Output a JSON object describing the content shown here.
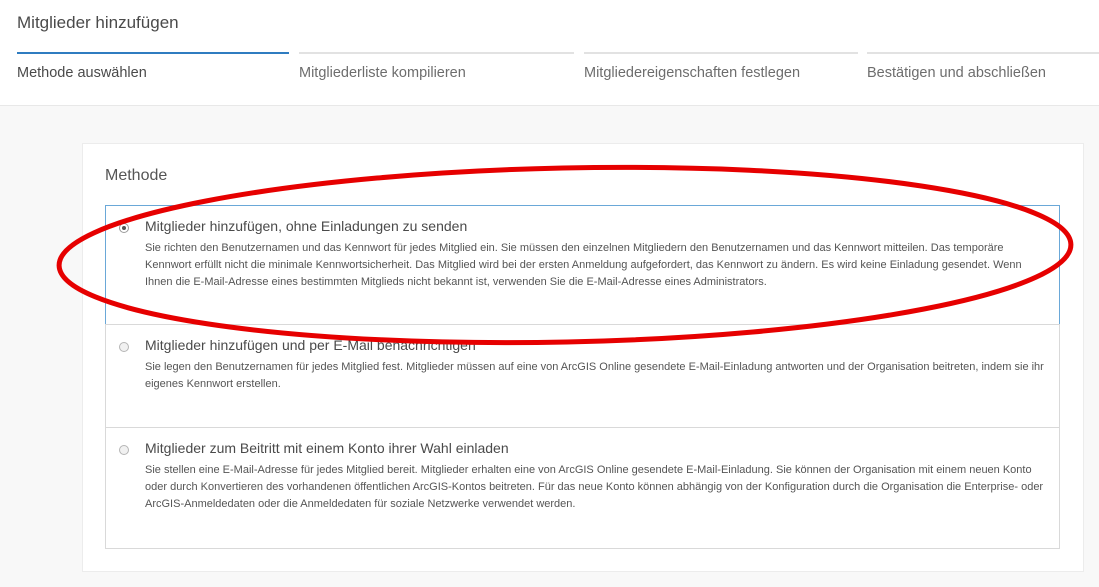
{
  "page": {
    "title": "Mitglieder hinzufügen"
  },
  "steps": [
    {
      "label": "Methode auswählen"
    },
    {
      "label": "Mitgliederliste kompilieren"
    },
    {
      "label": "Mitgliedereigenschaften festlegen"
    },
    {
      "label": "Bestätigen und abschließen"
    }
  ],
  "method": {
    "section_title": "Methode",
    "options": [
      {
        "title": "Mitglieder hinzufügen, ohne Einladungen zu senden",
        "description": "Sie richten den Benutzernamen und das Kennwort für jedes Mitglied ein. Sie müssen den einzelnen Mitgliedern den Benutzernamen und das Kennwort mitteilen. Das temporäre Kennwort erfüllt nicht die minimale Kennwortsicherheit. Das Mitglied wird bei der ersten Anmeldung aufgefordert, das Kennwort zu ändern. Es wird keine Einladung gesendet. Wenn Ihnen die E-Mail-Adresse eines bestimmten Mitglieds nicht bekannt ist, verwenden Sie die E-Mail-Adresse eines Administrators.",
        "selected": true
      },
      {
        "title": "Mitglieder hinzufügen und per E-Mail benachrichtigen",
        "description": "Sie legen den Benutzernamen für jedes Mitglied fest. Mitglieder müssen auf eine von ArcGIS Online gesendete E-Mail-Einladung antworten und der Organisation beitreten, indem sie ihr eigenes Kennwort erstellen.",
        "selected": false
      },
      {
        "title": "Mitglieder zum Beitritt mit einem Konto ihrer Wahl einladen",
        "description": "Sie stellen eine E-Mail-Adresse für jedes Mitglied bereit. Mitglieder erhalten eine von ArcGIS Online gesendete E-Mail-Einladung. Sie können der Organisation mit einem neuen Konto oder durch Konvertieren des vorhandenen öffentlichen ArcGIS-Kontos beitreten. Für das neue Konto können abhängig von der Konfiguration durch die Organisation die Enterprise- oder ArcGIS-Anmeldedaten oder die Anmeldedaten für soziale Netzwerke verwendet werden.",
        "selected": false
      }
    ]
  },
  "colors": {
    "accent": "#2f7cc0",
    "annotation": "#e60000"
  }
}
